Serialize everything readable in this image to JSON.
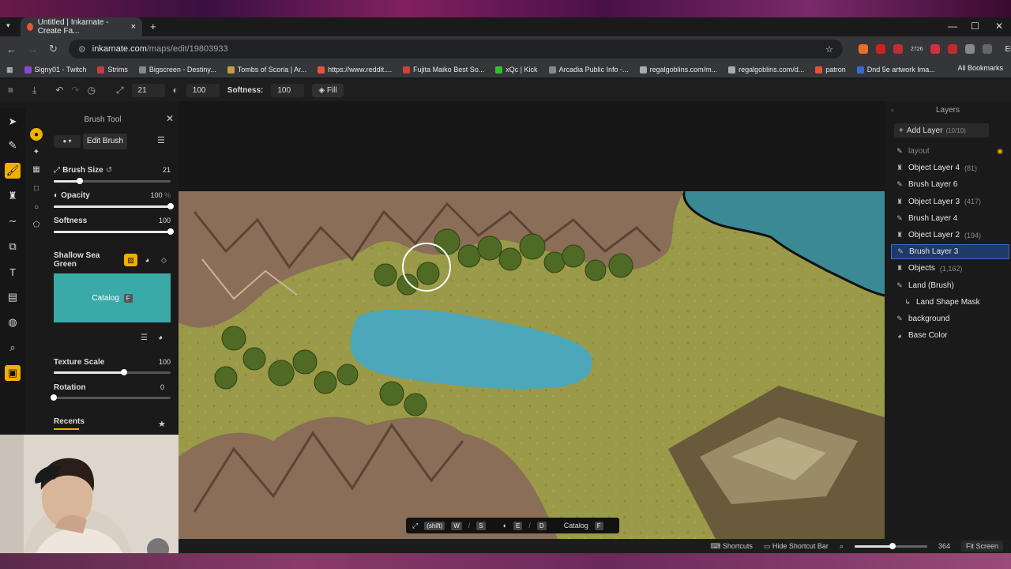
{
  "browser": {
    "tab_title": "Untitled | Inkarnate - Create Fa...",
    "url_host": "inkarnate.com",
    "url_path": "/maps/edit/19803933",
    "error_label": "Error",
    "badge_count": "2726",
    "bookmarks": [
      "Signy01 - Twitch",
      "Strims",
      "Bigscreen - Destiny...",
      "Tombs of Scoria | Ar...",
      "https://www.reddit....",
      "Fujita Maiko Best So...",
      "xQc | Kick",
      "Arcadia Public Info -...",
      "regalgoblins.com/m...",
      "regalgoblins.com/d...",
      "patron",
      "Dnd 5e artwork Ima..."
    ],
    "all_bookmarks": "All Bookmarks"
  },
  "toolbar": {
    "size_value": "21",
    "opacity_value": "100",
    "softness_label": "Softness:",
    "softness_value": "100",
    "fill_label": "Fill"
  },
  "brush_panel": {
    "title": "Brush Tool",
    "edit_brush": "Edit Brush",
    "brush_size_label": "Brush Size",
    "brush_size_value": "21",
    "brush_size_pct": 0.22,
    "opacity_label": "Opacity",
    "opacity_value": "100",
    "opacity_unit": "%",
    "opacity_pct": 1.0,
    "softness_label": "Softness",
    "softness_value": "100",
    "softness_pct": 1.0,
    "texture_name": "Shallow Sea Green",
    "catalog_label": "Catalog",
    "catalog_key": "F",
    "texture_color": "#3aaaa8",
    "texture_scale_label": "Texture Scale",
    "texture_scale_value": "100",
    "texture_scale_pct": 0.6,
    "rotation_label": "Rotation",
    "rotation_value": "0",
    "rotation_pct": 0.0,
    "recents_label": "Recents"
  },
  "layers_panel": {
    "title": "Layers",
    "add_layer": "Add Layer",
    "add_layer_count": "(10/10)",
    "layers": [
      {
        "name": "layout",
        "count": "",
        "icon": "brush-icon",
        "dim": true,
        "selected": false
      },
      {
        "name": "Object Layer 4",
        "count": "(81)",
        "icon": "object-icon",
        "dim": false,
        "selected": false
      },
      {
        "name": "Brush Layer 6",
        "count": "",
        "icon": "brush-icon",
        "dim": false,
        "selected": false
      },
      {
        "name": "Object Layer 3",
        "count": "(417)",
        "icon": "object-icon",
        "dim": false,
        "selected": false
      },
      {
        "name": "Brush Layer 4",
        "count": "",
        "icon": "brush-icon",
        "dim": false,
        "selected": false
      },
      {
        "name": "Object Layer 2",
        "count": "(194)",
        "icon": "object-icon",
        "dim": false,
        "selected": false
      },
      {
        "name": "Brush Layer 3",
        "count": "",
        "icon": "brush-icon",
        "dim": false,
        "selected": true
      },
      {
        "name": "Objects",
        "count": "(1,162)",
        "icon": "object-icon",
        "dim": false,
        "selected": false
      },
      {
        "name": "Land (Brush)",
        "count": "",
        "icon": "brush-icon",
        "dim": false,
        "selected": false
      },
      {
        "name": "Land Shape Mask",
        "count": "",
        "icon": "mask-icon",
        "dim": false,
        "selected": false
      },
      {
        "name": "background",
        "count": "",
        "icon": "brush-icon",
        "dim": false,
        "selected": false
      },
      {
        "name": "Base Color",
        "count": "",
        "icon": "palette-icon",
        "dim": false,
        "selected": false
      }
    ]
  },
  "shortcut_bar": {
    "shift": "(shift)",
    "w": "W",
    "s": "S",
    "e": "E",
    "d": "D",
    "catalog": "Catalog",
    "f": "F"
  },
  "bottom_bar": {
    "shortcuts": "Shortcuts",
    "hide_shortcut_bar": "Hide Shortcut Bar",
    "zoom_value": "364",
    "fit_screen": "Fit Screen"
  }
}
